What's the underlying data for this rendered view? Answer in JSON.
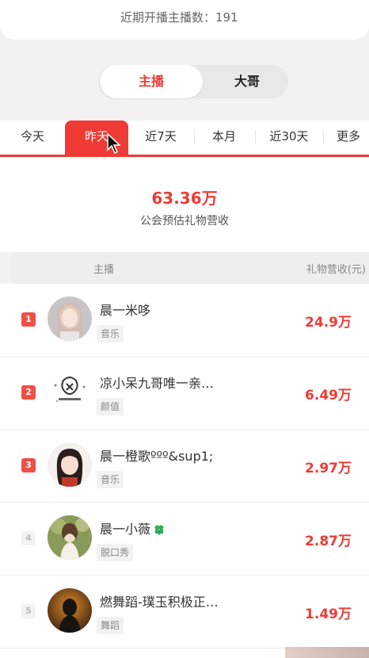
{
  "top_card": {
    "text": "近期开播主播数：191"
  },
  "segment": {
    "options": [
      "主播",
      "大哥"
    ],
    "selected": "主播"
  },
  "tabs": [
    "今天",
    "昨天",
    "近7天",
    "本月",
    "近30天",
    "更多"
  ],
  "active_tab": "昨天",
  "summary": {
    "value": "63.36万",
    "label": "公会预估礼物营收"
  },
  "table": {
    "col_anchor": "主播",
    "col_revenue": "礼物营收(元)"
  },
  "rows": [
    {
      "rank": "1",
      "name": "晨一米哆",
      "tag": "音乐",
      "amount": "24.9万",
      "avatar": "avatar-girl-1"
    },
    {
      "rank": "2",
      "name": "凉小呆九哥唯一亲…",
      "tag": "颜值",
      "amount": "6.49万",
      "avatar": "avatar-text-logo"
    },
    {
      "rank": "3",
      "name": "晨一橙歌ººº&sup1;",
      "tag": "音乐",
      "amount": "2.97万",
      "avatar": "avatar-cartoon-girl"
    },
    {
      "rank": "4",
      "name": "晨一小薇",
      "tag": "脱口秀",
      "amount": "2.87万",
      "avatar": "avatar-girl-outdoor",
      "badge": "clover-icon"
    },
    {
      "rank": "5",
      "name": "燃舞蹈-璞玉积极正…",
      "tag": "舞蹈",
      "amount": "1.49万",
      "avatar": "avatar-dark-silhouette"
    }
  ],
  "colors": {
    "accent": "#ee3b36",
    "rank_top": "#ef4f46"
  }
}
